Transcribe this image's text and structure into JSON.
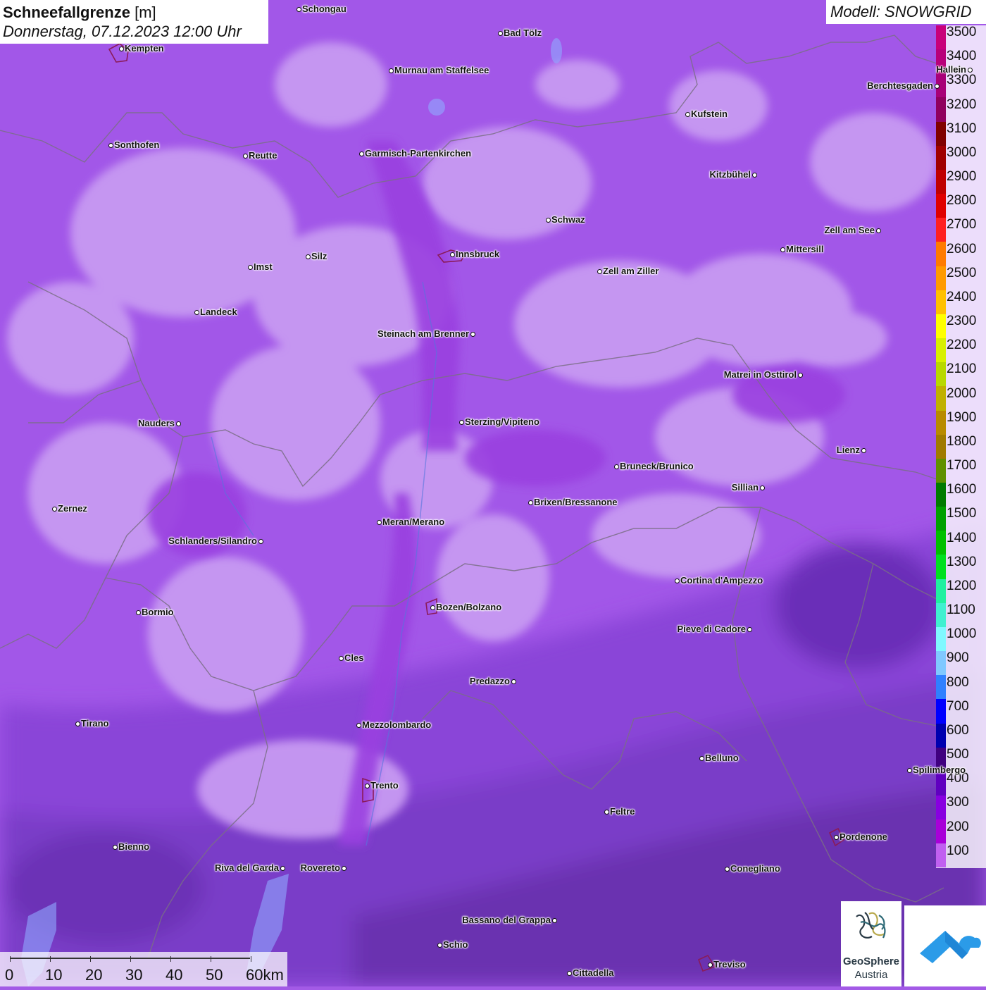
{
  "title": {
    "variable": "Schneefallgrenze",
    "unit": "[m]",
    "datetime": "Donnerstag, 07.12.2023 12:00 Uhr"
  },
  "model_label": "Modell: SNOWGRID",
  "legend": {
    "labels": [
      "3500",
      "3400",
      "3300",
      "3200",
      "3100",
      "3000",
      "2900",
      "2800",
      "2700",
      "2600",
      "2500",
      "2400",
      "2300",
      "2200",
      "2100",
      "2000",
      "1900",
      "1800",
      "1700",
      "1600",
      "1500",
      "1400",
      "1300",
      "1200",
      "1100",
      "1000",
      "900",
      "800",
      "700",
      "600",
      "500",
      "400",
      "300",
      "200",
      "100"
    ],
    "colors": [
      "#c8007a",
      "#b8007a",
      "#a80078",
      "#90005e",
      "#800000",
      "#a00000",
      "#c00000",
      "#e00000",
      "#ff2020",
      "#ff7a00",
      "#ff9a00",
      "#ffc000",
      "#ffff00",
      "#d8f000",
      "#b8d800",
      "#c0b000",
      "#b88a00",
      "#a07a00",
      "#609000",
      "#007a00",
      "#00a000",
      "#00c000",
      "#00e020",
      "#20f0a0",
      "#40f0d0",
      "#80f8ff",
      "#80c8ff",
      "#3080ff",
      "#0000ff",
      "#0000b0",
      "#400080",
      "#6000c0",
      "#8800e0",
      "#a800d8",
      "#c060f0"
    ]
  },
  "cities": [
    {
      "name": "Schongau"
    },
    {
      "name": "Kempten"
    },
    {
      "name": "Bad Tölz"
    },
    {
      "name": "Murnau am Staffelsee"
    },
    {
      "name": "Hallein"
    },
    {
      "name": "Berchtesgaden"
    },
    {
      "name": "Kufstein"
    },
    {
      "name": "Sonthofen"
    },
    {
      "name": "Reutte"
    },
    {
      "name": "Garmisch-Partenkirchen"
    },
    {
      "name": "Kitzbühel"
    },
    {
      "name": "Schwaz"
    },
    {
      "name": "Zell am See"
    },
    {
      "name": "Mittersill"
    },
    {
      "name": "Imst"
    },
    {
      "name": "Silz"
    },
    {
      "name": "Innsbruck"
    },
    {
      "name": "Zell am Ziller"
    },
    {
      "name": "Landeck"
    },
    {
      "name": "Steinach am Brenner"
    },
    {
      "name": "Matrei in Osttirol"
    },
    {
      "name": "Nauders"
    },
    {
      "name": "Sterzing/Vipiteno"
    },
    {
      "name": "Lienz"
    },
    {
      "name": "Bruneck/Brunico"
    },
    {
      "name": "Sillian"
    },
    {
      "name": "Zernez"
    },
    {
      "name": "Brixen/Bressanone"
    },
    {
      "name": "Meran/Merano"
    },
    {
      "name": "Schlanders/Silandro"
    },
    {
      "name": "Cortina d'Ampezzo"
    },
    {
      "name": "Bozen/Bolzano"
    },
    {
      "name": "Bormio"
    },
    {
      "name": "Pieve di Cadore"
    },
    {
      "name": "Cles"
    },
    {
      "name": "Predazzo"
    },
    {
      "name": "Tirano"
    },
    {
      "name": "Mezzolombardo"
    },
    {
      "name": "Belluno"
    },
    {
      "name": "Spilimbergo"
    },
    {
      "name": "Trento"
    },
    {
      "name": "Feltre"
    },
    {
      "name": "Pordenone"
    },
    {
      "name": "Bienno"
    },
    {
      "name": "Riva del Garda"
    },
    {
      "name": "Rovereto"
    },
    {
      "name": "Conegliano"
    },
    {
      "name": "Bassano del Grappa"
    },
    {
      "name": "Schio"
    },
    {
      "name": "Treviso"
    },
    {
      "name": "Cittadella"
    }
  ],
  "scale": {
    "labels": [
      "0",
      "10",
      "20",
      "30",
      "40",
      "50",
      "60km"
    ]
  },
  "logo": {
    "name": "GeoSphere",
    "sub": "Austria"
  }
}
